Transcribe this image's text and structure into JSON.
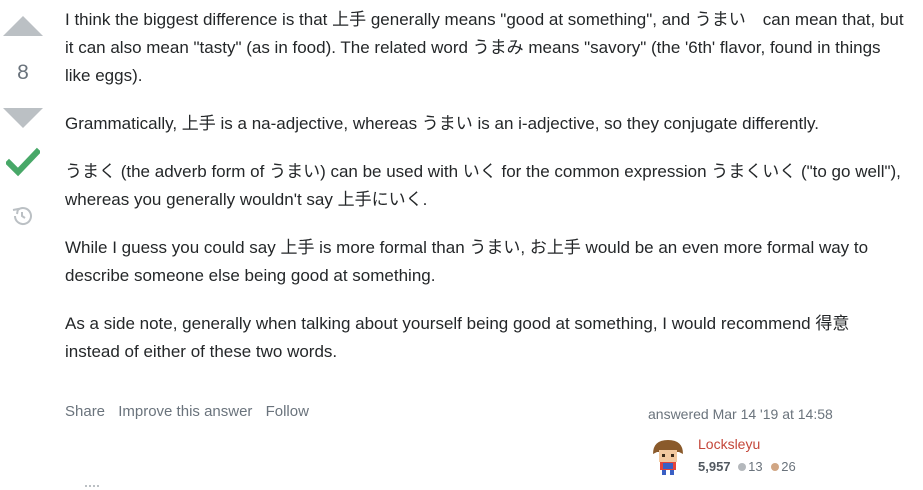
{
  "vote": {
    "count": "8",
    "up_icon": "arrow-up-icon",
    "down_icon": "arrow-down-icon",
    "accepted_icon": "checkmark-icon",
    "history_icon": "history-icon",
    "accepted_color": "#48a868",
    "arrow_color": "#bbc0c4"
  },
  "post": {
    "paragraphs": [
      "I think the biggest difference is that 上手 generally means \"good at something\", and うまい　can mean that, but it can also mean \"tasty\" (as in food). The related word うまみ means \"savory\" (the '6th' flavor, found in things like eggs).",
      "Grammatically, 上手 is a na-adjective, whereas うまい is an i-adjective, so they conjugate differently.",
      "うまく (the adverb form of うまい) can be used with いく for the common expression うまくいく (\"to go well\"), whereas you generally wouldn't say 上手にいく.",
      "While I guess you could say 上手 is more formal than うまい, お上手 would be an even more formal way to describe someone else being good at something.",
      "As a side note, generally when talking about yourself being good at something, I would recommend 得意 instead of either of these two words."
    ]
  },
  "menu": {
    "share": "Share",
    "improve": "Improve this answer",
    "follow": "Follow"
  },
  "user": {
    "action_time": "answered Mar 14 '19 at 14:58",
    "name": "Locksleyu",
    "reputation": "5,957",
    "silver_badges": "13",
    "bronze_badges": "26",
    "name_color": "#c4473a"
  }
}
